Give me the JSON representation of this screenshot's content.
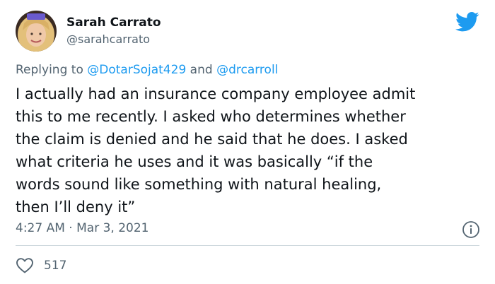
{
  "author": {
    "display_name": "Sarah Carrato",
    "handle": "@sarahcarrato"
  },
  "reply_context": {
    "prefix": "Replying to ",
    "mentions": [
      "@DotarSojat429",
      "@drcarroll"
    ],
    "conjunction": " and "
  },
  "tweet": {
    "text_lines": [
      "I actually had an insurance company employee admit",
      "this to me recently. I asked who determines whether",
      "the claim is denied and he said that he does. I asked",
      "what criteria he uses and it was basically “if the",
      "words sound like something with natural healing,",
      "then I’ll deny it”"
    ],
    "time": "4:27 AM",
    "separator": " · ",
    "date": "Mar 3, 2021"
  },
  "engagement": {
    "likes": "517"
  },
  "icons": {
    "brand": "twitter-bird-icon",
    "info": "info-icon",
    "like": "heart-icon"
  },
  "colors": {
    "accent": "#1d9bf0",
    "text_primary": "#0f1419",
    "text_secondary": "#536471",
    "divider": "#cfd9de"
  }
}
